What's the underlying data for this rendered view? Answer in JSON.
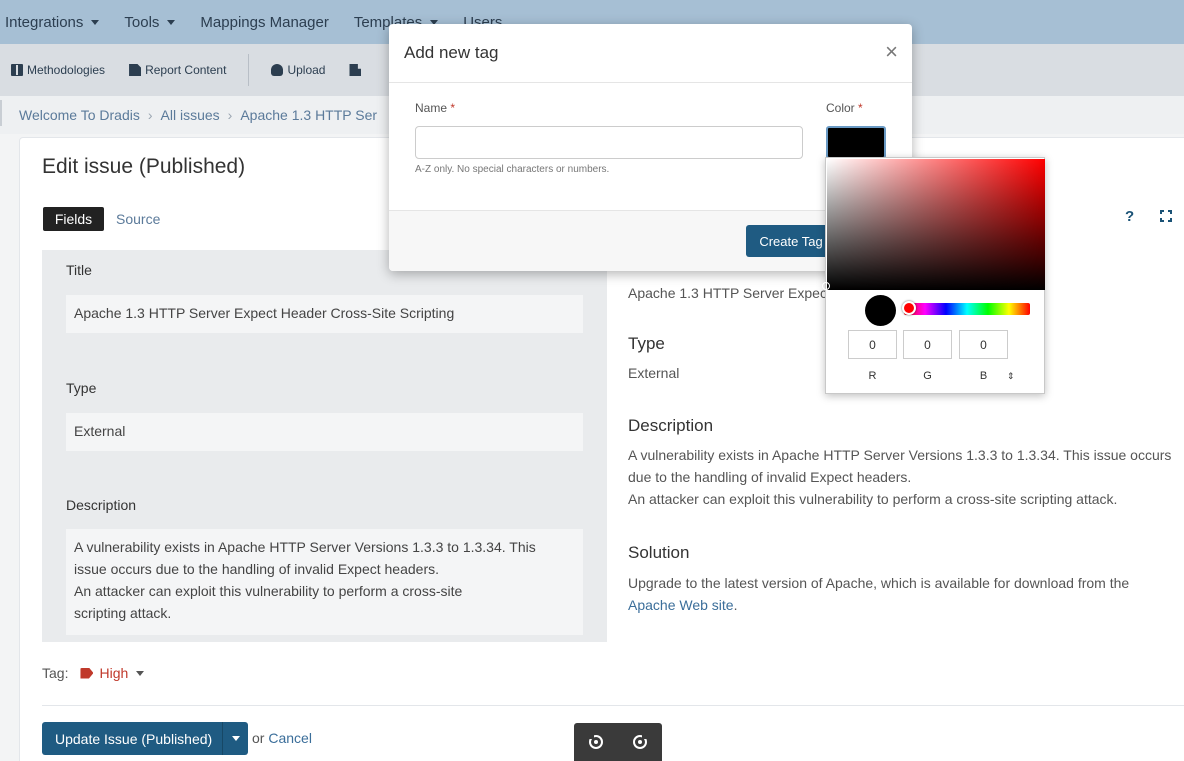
{
  "topnav": {
    "items": [
      "Integrations",
      "Tools",
      "Mappings Manager",
      "Templates",
      "Users"
    ]
  },
  "toolbar": {
    "methodologies": "Methodologies",
    "report_content": "Report Content",
    "upload": "Upload"
  },
  "breadcrumb": {
    "home": "Welcome To Dradis",
    "issues": "All issues",
    "current": "Apache 1.3 HTTP Ser"
  },
  "page": {
    "title": "Edit issue (Published)",
    "tab_fields": "Fields",
    "tab_source": "Source",
    "help": "?"
  },
  "editor": {
    "title_label": "Title",
    "title_value": "Apache 1.3 HTTP Server Expect Header Cross-Site Scripting",
    "type_label": "Type",
    "type_value": "External",
    "description_label": "Description",
    "description_lines": [
      "A vulnerability exists in Apache HTTP Server Versions 1.3.3 to 1.3.34. This",
      "issue occurs due to the handling of invalid Expect headers.",
      "An attacker can exploit this vulnerability to perform a cross-site",
      "scripting attack."
    ]
  },
  "preview": {
    "title_text": "Apache 1.3 HTTP Server Expec",
    "type_heading": "Type",
    "type_text": "External",
    "description_heading": "Description",
    "description_lines": [
      "A vulnerability exists in Apache HTTP Server Versions 1.3.3 to 1.3.34. This issue occurs",
      "due to the handling of invalid Expect headers.",
      "An attacker can exploit this vulnerability to perform a cross-site scripting attack."
    ],
    "solution_heading": "Solution",
    "solution_line1": "Upgrade to the latest version of Apache, which is available for download from the",
    "solution_link": "Apache Web site",
    "solution_end": "."
  },
  "tag": {
    "label": "Tag:",
    "value": "High",
    "color": "#c0392b"
  },
  "actions": {
    "update_label": "Update Issue (Published)",
    "or": "or",
    "cancel": "Cancel"
  },
  "modal": {
    "title": "Add new tag",
    "close": "×",
    "name_label": "Name",
    "required_mark": "*",
    "name_value": "",
    "name_help": "A-Z only. No special characters or numbers.",
    "color_label": "Color",
    "color_value": "#000000",
    "create_label": "Create Tag"
  },
  "picker": {
    "r": "0",
    "g": "0",
    "b": "0",
    "r_label": "R",
    "g_label": "G",
    "b_label": "B",
    "mode_toggle": "⇕"
  }
}
